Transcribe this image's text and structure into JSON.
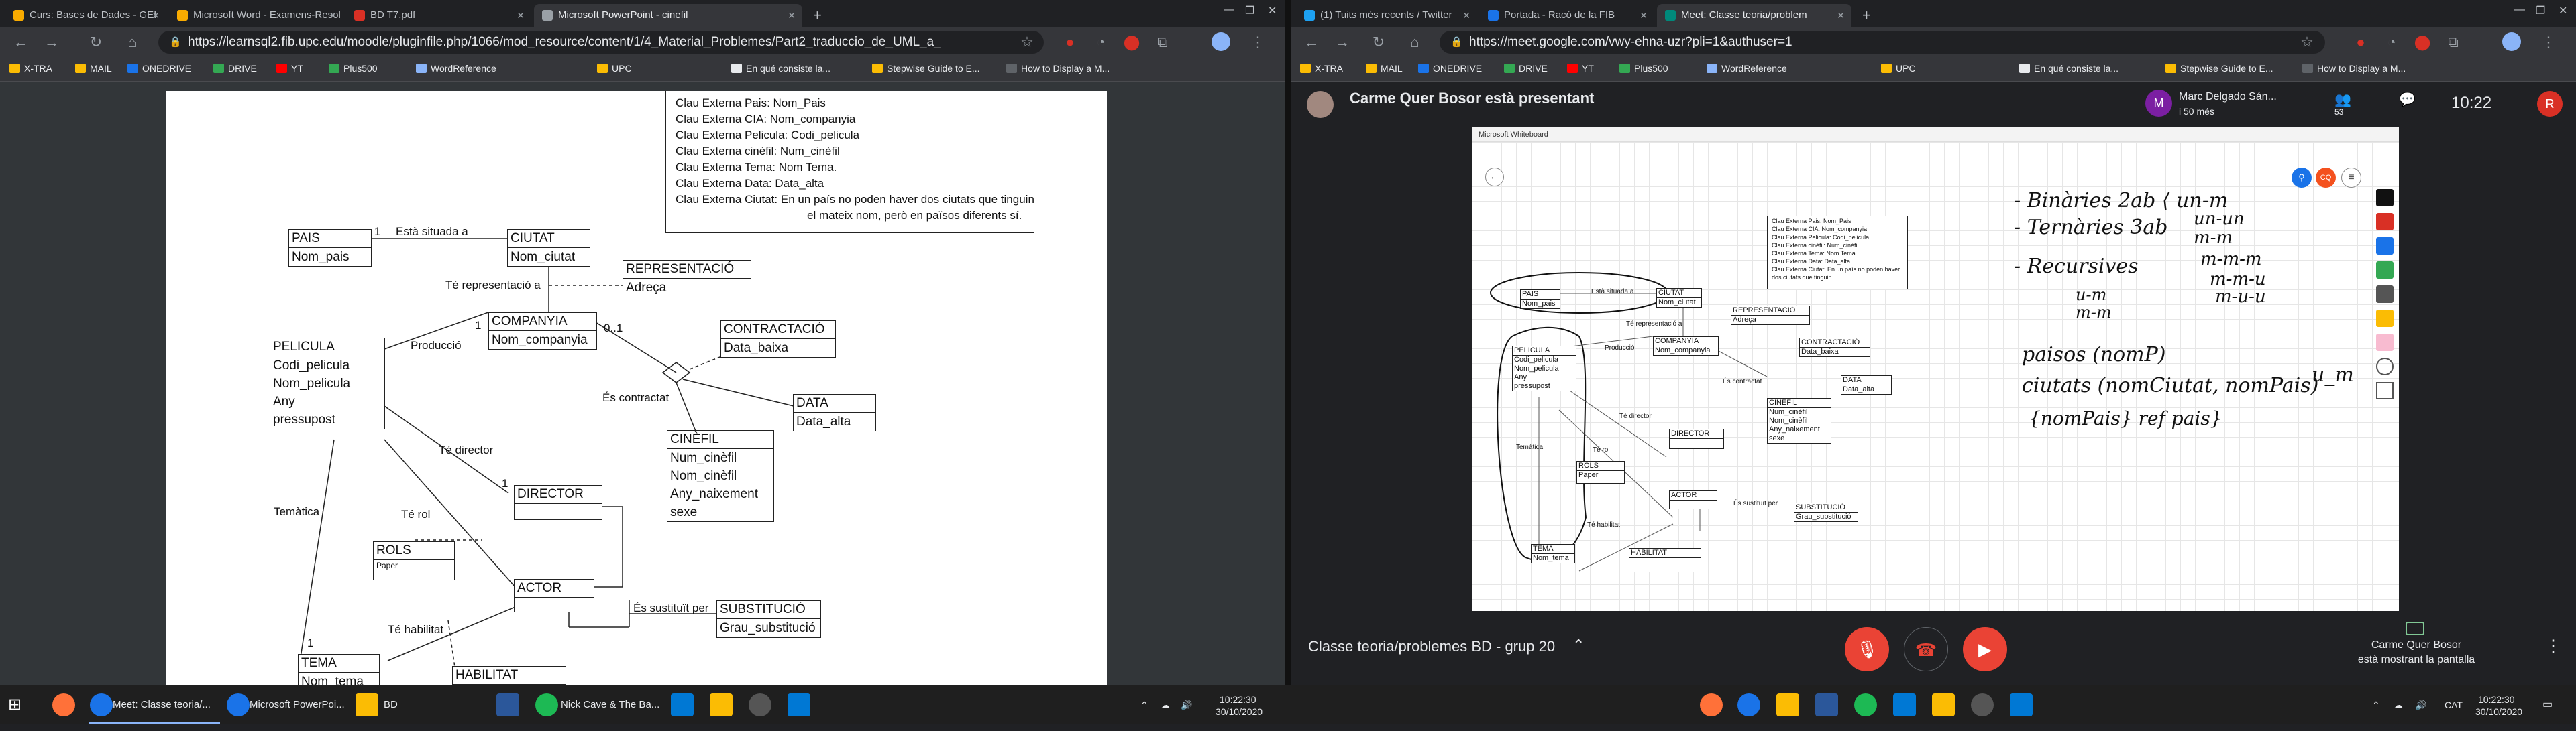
{
  "left_window": {
    "tabs": [
      {
        "title": "Curs: Bases de Dades - GEI",
        "color": "#f9ab00"
      },
      {
        "title": "Microsoft Word - Examens-Resol",
        "color": "#f9ab00"
      },
      {
        "title": "BD T7.pdf",
        "color": "#d93025"
      },
      {
        "title": "Microsoft PowerPoint - cinefil",
        "color": "#9aa0a6",
        "active": true
      }
    ],
    "url": "https://learnsql2.fib.upc.edu/moodle/pluginfile.php/1066/mod_resource/content/1/4_Material_Problemes/Part2_traduccio_de_UML_a_",
    "bookmarks": [
      "X-TRA",
      "MAIL",
      "ONEDRIVE",
      "DRIVE",
      "YT",
      "Plus500",
      "WordReference",
      "UPC",
      "En qué consiste la...",
      "Stepwise Guide to E...",
      "How to Display a M..."
    ]
  },
  "right_window": {
    "tabs": [
      {
        "title": "(1) Tuits més recents / Twitter",
        "color": "#1da1f2"
      },
      {
        "title": "Portada - Racó de la FIB",
        "color": "#1a73e8"
      },
      {
        "title": "Meet: Classe teoria/problem",
        "color": "#00897b",
        "active": true
      }
    ],
    "url": "https://meet.google.com/vwy-ehna-uzr?pli=1&authuser=1",
    "bookmarks": [
      "X-TRA",
      "MAIL",
      "ONEDRIVE",
      "DRIVE",
      "YT",
      "Plus500",
      "WordReference",
      "UPC",
      "En qué consiste la...",
      "Stepwise Guide to E...",
      "How to Display a M..."
    ],
    "presenter": "Carme Quer Bosor està presentant",
    "participant_name": "Marc Delgado Sán...",
    "participant_status": "i 50 més",
    "meet_time": "10:22",
    "meet_count": "53",
    "avatar_letter": "R",
    "meeting_title": "Classe teoria/problemes BD - grup 20",
    "presenting_name": "Carme Quer Bosor",
    "presenting_status": "està mostrant la pantalla",
    "whiteboard_title": "Microsoft Whiteboard",
    "whiteboard_avatar": "CQ"
  },
  "diagram": {
    "notes": [
      "Clau Externa Pais: Nom_Pais",
      "Clau Externa CIA: Nom_companyia",
      "Clau Externa Pelicula: Codi_pelicula",
      "Clau Externa cinèfil: Num_cinèfil",
      "Clau Externa Tema: Nom Tema.",
      "Clau Externa Data: Data_alta",
      "Clau Externa Ciutat: En un país no poden haver dos ciutats que tinguin",
      "el mateix nom,  però en països diferents sí."
    ],
    "classes": {
      "pais": {
        "name": "PAIS",
        "attrs": [
          "Nom_pais"
        ]
      },
      "ciutat": {
        "name": "CIUTAT",
        "attrs": [
          "Nom_ciutat"
        ]
      },
      "representacio": {
        "name": "REPRESENTACIÓ",
        "attrs": [
          "Adreça"
        ]
      },
      "companyia": {
        "name": "COMPANYIA",
        "attrs": [
          "Nom_companyia"
        ]
      },
      "contractacio": {
        "name": "CONTRACTACIÓ",
        "attrs": [
          "Data_baixa"
        ]
      },
      "pelicula": {
        "name": "PELICULA",
        "attrs": [
          "Codi_pelicula",
          "Nom_pelicula",
          "Any",
          "pressupost"
        ]
      },
      "data": {
        "name": "DATA",
        "attrs": [
          "Data_alta"
        ]
      },
      "cinefil": {
        "name": "CINÈFIL",
        "attrs": [
          "Num_cinèfil",
          "Nom_cinèfil",
          "Any_naixement",
          "sexe"
        ]
      },
      "director": {
        "name": "DIRECTOR",
        "attrs": []
      },
      "rols": {
        "name": "ROLS",
        "attrs": [
          "Paper"
        ]
      },
      "actor": {
        "name": "ACTOR",
        "attrs": []
      },
      "substitucio": {
        "name": "SUBSTITUCIÓ",
        "attrs": [
          "Grau_substitució"
        ]
      },
      "tema": {
        "name": "TEMA",
        "attrs": [
          "Nom_tema"
        ]
      },
      "habilitat": {
        "name": "HABILITAT",
        "attrs": []
      }
    },
    "labels": {
      "situada": "Està situada a",
      "representacio": "Té representació a",
      "produccio": "Producció",
      "contractat": "És contractat",
      "director": "Té director",
      "rol": "Té rol",
      "tematica": "Temàtica",
      "habilitat": "Té habilitat",
      "sustituit": "És sustituït per",
      "m1": "1",
      "m01": "0..1",
      "star": "*"
    }
  },
  "handwriting": {
    "line1": "- Binàries 2ab  ⟨ un-m",
    "line1b": "un-un",
    "line1c": "m-m",
    "line2": "- Ternàries 3ab",
    "line2b": "m-m-m",
    "line2c": "m-m-u",
    "line3": "- Recursives",
    "line3b": "m-u-u",
    "line3d": "u-m",
    "line3e": "m-m",
    "f1": "paisos (nomP)",
    "f2": "ciutats (nomCiutat, nomPais)",
    "f2b": "u_m",
    "f3": "{nomPais} ref pais}"
  },
  "taskbar": {
    "items": [
      "Meet: Classe teoria/...",
      "Microsoft PowerPoi...",
      "BD",
      "Nick Cave & The Ba..."
    ],
    "time": "10:22:30",
    "date": "30/10/2020",
    "lang": "CAT"
  }
}
